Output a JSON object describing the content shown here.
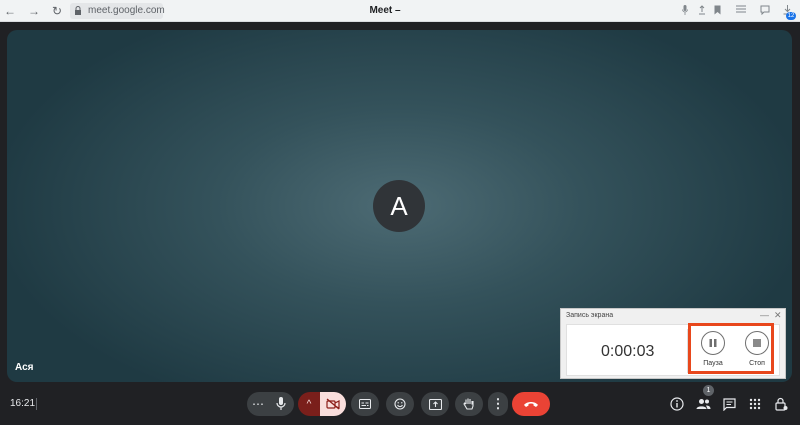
{
  "browser": {
    "back_glyph": "←",
    "forward_glyph": "→",
    "reload_glyph": "↻",
    "url": "meet.google.com",
    "tab_title": "Meet –",
    "extensions_count": "12"
  },
  "meeting": {
    "avatar_letter": "A",
    "participant_name": "Ася",
    "clock": "16:21",
    "people_count": "1",
    "accent_end_call": "#ea4335",
    "accent_cam_off": "#f9dedc"
  },
  "recorder": {
    "title": "Запись экрана",
    "minimize_glyph": "—",
    "close_glyph": "✕",
    "timer": "0:00:03",
    "pause_label": "Пауза",
    "stop_label": "Стоп",
    "highlight_color": "#e8471c"
  },
  "icons": {
    "more_options_glyph": "⋯",
    "vertical_more_glyph": "⋮",
    "chevron_glyph": "^"
  }
}
